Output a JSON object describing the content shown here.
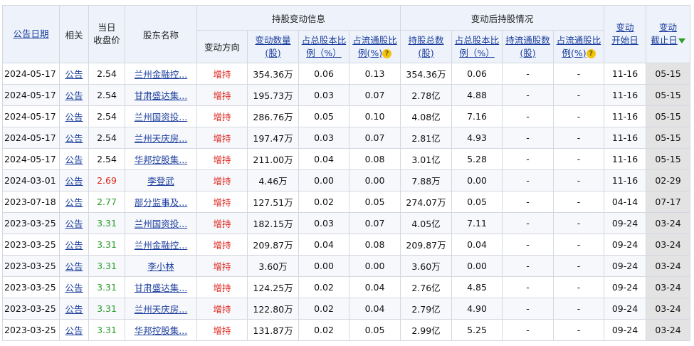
{
  "headers": {
    "notice_date": "公告日期",
    "related": "相关",
    "close_price_l1": "当日",
    "close_price_l2": "收盘价",
    "holder_name": "股东名称",
    "change_info_group": "持股变动信息",
    "direction": "变动方向",
    "change_amount_l1": "变动数量",
    "change_amount_l2": "(股)",
    "change_total_pct_l1": "占总股本比",
    "change_total_pct_l2": "例（%）",
    "change_float_pct_l1": "占流通股比",
    "change_float_pct_l2": "例(%)",
    "after_group": "变动后持股情况",
    "after_total_shares_l1": "持股总数",
    "after_total_shares_l2": "(股)",
    "after_total_pct_l1": "占总股本比",
    "after_total_pct_l2": "例（%）",
    "after_float_shares_l1": "持流通股数",
    "after_float_shares_l2": "(股)",
    "after_float_pct_l1": "占流通股比",
    "after_float_pct_l2": "例(%)",
    "start_date_l1": "变动",
    "start_date_l2": "开始日",
    "end_date_l1": "变动",
    "end_date_l2": "截止日"
  },
  "icons": {
    "help": "question-mark-icon",
    "sort": "sort-desc-arrow-icon"
  },
  "colors": {
    "price_up": "#e0231b",
    "price_flat": "#2a9d2a",
    "link": "#1a3c9c"
  },
  "rows": [
    {
      "date": "2024-05-17",
      "related": "公告",
      "price": "2.54",
      "price_state": "normal",
      "holder": "兰州金融控...",
      "direction": "增持",
      "change_amt": "354.36万",
      "change_total_pct": "0.06",
      "change_float_pct": "0.13",
      "after_total": "354.36万",
      "after_total_pct": "0.06",
      "after_float": "-",
      "after_float_pct": "-",
      "start": "11-16",
      "end": "05-15"
    },
    {
      "date": "2024-05-17",
      "related": "公告",
      "price": "2.54",
      "price_state": "normal",
      "holder": "甘肃盛达集...",
      "direction": "增持",
      "change_amt": "195.73万",
      "change_total_pct": "0.03",
      "change_float_pct": "0.07",
      "after_total": "2.78亿",
      "after_total_pct": "4.88",
      "after_float": "-",
      "after_float_pct": "-",
      "start": "11-16",
      "end": "05-15"
    },
    {
      "date": "2024-05-17",
      "related": "公告",
      "price": "2.54",
      "price_state": "normal",
      "holder": "兰州国资投...",
      "direction": "增持",
      "change_amt": "286.76万",
      "change_total_pct": "0.05",
      "change_float_pct": "0.10",
      "after_total": "4.08亿",
      "after_total_pct": "7.16",
      "after_float": "-",
      "after_float_pct": "-",
      "start": "11-16",
      "end": "05-15"
    },
    {
      "date": "2024-05-17",
      "related": "公告",
      "price": "2.54",
      "price_state": "normal",
      "holder": "兰州天庆房...",
      "direction": "增持",
      "change_amt": "197.47万",
      "change_total_pct": "0.03",
      "change_float_pct": "0.07",
      "after_total": "2.81亿",
      "after_total_pct": "4.93",
      "after_float": "-",
      "after_float_pct": "-",
      "start": "11-16",
      "end": "05-15"
    },
    {
      "date": "2024-05-17",
      "related": "公告",
      "price": "2.54",
      "price_state": "normal",
      "holder": "华邦控股集...",
      "direction": "增持",
      "change_amt": "211.00万",
      "change_total_pct": "0.04",
      "change_float_pct": "0.08",
      "after_total": "3.01亿",
      "after_total_pct": "5.28",
      "after_float": "-",
      "after_float_pct": "-",
      "start": "11-16",
      "end": "05-15"
    },
    {
      "date": "2024-03-01",
      "related": "公告",
      "price": "2.69",
      "price_state": "up",
      "holder": "李登武",
      "direction": "增持",
      "change_amt": "4.46万",
      "change_total_pct": "0.00",
      "change_float_pct": "0.00",
      "after_total": "7.88万",
      "after_total_pct": "0.00",
      "after_float": "-",
      "after_float_pct": "-",
      "start": "11-16",
      "end": "02-29"
    },
    {
      "date": "2023-07-18",
      "related": "公告",
      "price": "2.77",
      "price_state": "flat",
      "holder": "部分监事及...",
      "direction": "增持",
      "change_amt": "127.51万",
      "change_total_pct": "0.02",
      "change_float_pct": "0.05",
      "after_total": "274.07万",
      "after_total_pct": "0.05",
      "after_float": "-",
      "after_float_pct": "-",
      "start": "04-14",
      "end": "07-17"
    },
    {
      "date": "2023-03-25",
      "related": "公告",
      "price": "3.31",
      "price_state": "flat",
      "holder": "兰州国资投...",
      "direction": "增持",
      "change_amt": "182.15万",
      "change_total_pct": "0.03",
      "change_float_pct": "0.07",
      "after_total": "4.05亿",
      "after_total_pct": "7.11",
      "after_float": "-",
      "after_float_pct": "-",
      "start": "09-24",
      "end": "03-24"
    },
    {
      "date": "2023-03-25",
      "related": "公告",
      "price": "3.31",
      "price_state": "flat",
      "holder": "兰州金融控...",
      "direction": "增持",
      "change_amt": "209.87万",
      "change_total_pct": "0.04",
      "change_float_pct": "0.08",
      "after_total": "209.87万",
      "after_total_pct": "0.04",
      "after_float": "-",
      "after_float_pct": "-",
      "start": "09-24",
      "end": "03-24"
    },
    {
      "date": "2023-03-25",
      "related": "公告",
      "price": "3.31",
      "price_state": "flat",
      "holder": "李小林",
      "direction": "增持",
      "change_amt": "3.60万",
      "change_total_pct": "0.00",
      "change_float_pct": "0.00",
      "after_total": "3.60万",
      "after_total_pct": "0.00",
      "after_float": "-",
      "after_float_pct": "-",
      "start": "09-24",
      "end": "03-24"
    },
    {
      "date": "2023-03-25",
      "related": "公告",
      "price": "3.31",
      "price_state": "flat",
      "holder": "甘肃盛达集...",
      "direction": "增持",
      "change_amt": "124.25万",
      "change_total_pct": "0.02",
      "change_float_pct": "0.04",
      "after_total": "2.76亿",
      "after_total_pct": "4.85",
      "after_float": "-",
      "after_float_pct": "-",
      "start": "09-24",
      "end": "03-24"
    },
    {
      "date": "2023-03-25",
      "related": "公告",
      "price": "3.31",
      "price_state": "flat",
      "holder": "兰州天庆房...",
      "direction": "增持",
      "change_amt": "122.80万",
      "change_total_pct": "0.02",
      "change_float_pct": "0.04",
      "after_total": "2.79亿",
      "after_total_pct": "4.90",
      "after_float": "-",
      "after_float_pct": "-",
      "start": "09-24",
      "end": "03-24"
    },
    {
      "date": "2023-03-25",
      "related": "公告",
      "price": "3.31",
      "price_state": "flat",
      "holder": "华邦控股集...",
      "direction": "增持",
      "change_amt": "131.87万",
      "change_total_pct": "0.02",
      "change_float_pct": "0.05",
      "after_total": "2.99亿",
      "after_total_pct": "5.25",
      "after_float": "-",
      "after_float_pct": "-",
      "start": "09-24",
      "end": "03-24"
    }
  ]
}
